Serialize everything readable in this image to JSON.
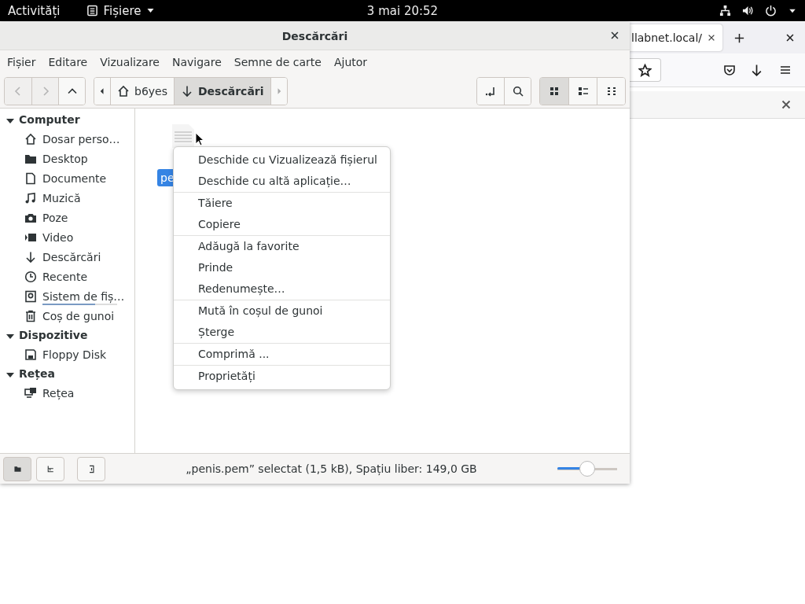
{
  "top_bar": {
    "activities": "Activități",
    "app_menu": "Fișiere",
    "clock": "3 mai  20:52"
  },
  "browser": {
    "tab_title": "llabnet.local/"
  },
  "window": {
    "title": "Descărcări",
    "menu": [
      "Fișier",
      "Editare",
      "Vizualizare",
      "Navigare",
      "Semne de carte",
      "Ajutor"
    ],
    "nav": [
      {
        "kind": "back",
        "disabled": true
      },
      {
        "kind": "forward",
        "disabled": true
      },
      {
        "kind": "up",
        "disabled": false
      }
    ],
    "path": [
      {
        "label": "b6yes",
        "kind": "home",
        "selected": false
      },
      {
        "label": "Descărcări",
        "kind": "download",
        "selected": true
      }
    ],
    "views": [
      {
        "kind": "grid",
        "selected": true
      },
      {
        "kind": "list",
        "selected": false
      },
      {
        "kind": "compact",
        "selected": false
      }
    ]
  },
  "sidebar": {
    "sections": [
      {
        "title": "Computer",
        "expanded": true,
        "items": [
          {
            "label": "Dosar perso…",
            "kind": "home"
          },
          {
            "label": "Desktop",
            "kind": "folder"
          },
          {
            "label": "Documente",
            "kind": "document"
          },
          {
            "label": "Muzică",
            "kind": "music"
          },
          {
            "label": "Poze",
            "kind": "camera"
          },
          {
            "label": "Video",
            "kind": "video"
          },
          {
            "label": "Descărcări",
            "kind": "download"
          },
          {
            "label": "Recente",
            "kind": "clock"
          },
          {
            "label": "Sistem de fiș…",
            "kind": "drive",
            "level": 0.7
          },
          {
            "label": "Coș de gunoi",
            "kind": "trash"
          }
        ]
      },
      {
        "title": "Dispozitive",
        "expanded": true,
        "items": [
          {
            "label": "Floppy Disk",
            "kind": "floppy"
          }
        ]
      },
      {
        "title": "Rețea",
        "expanded": true,
        "items": [
          {
            "label": "Rețea",
            "kind": "network"
          }
        ]
      }
    ]
  },
  "files": [
    {
      "name": "pe",
      "selected": true
    }
  ],
  "context_menu": {
    "sections": [
      [
        "Deschide cu Vizualizează fișierul",
        "Deschide cu altă aplicație…"
      ],
      [
        "Tăiere",
        "Copiere"
      ],
      [
        "Adăugă la favorite",
        "Prinde",
        "Redenumește…"
      ],
      [
        "Mută în coșul de gunoi",
        "Șterge"
      ],
      [
        "Comprimă ..."
      ],
      [
        "Proprietăți"
      ]
    ]
  },
  "status_bar": {
    "panes": [
      {
        "kind": "places",
        "selected": true
      },
      {
        "kind": "tree",
        "selected": false
      }
    ],
    "text": "„penis.pem” selectat (1,5 kB), Spațiu liber: 149,0 GB",
    "zoom": {
      "level": 0.5
    }
  }
}
